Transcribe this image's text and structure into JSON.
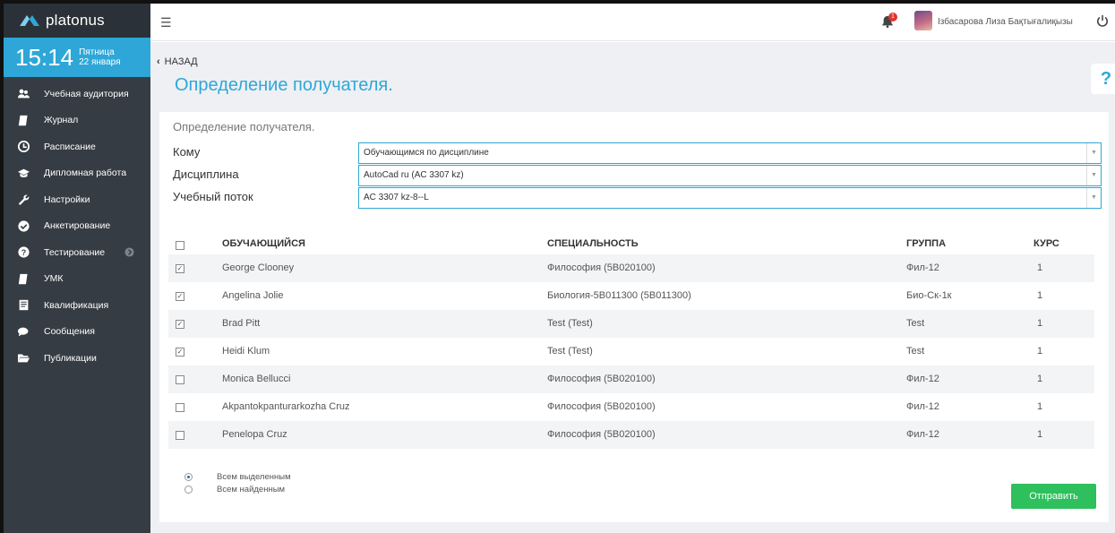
{
  "app": {
    "name": "platonus"
  },
  "clock": {
    "time": "15:14",
    "weekday": "Пятница",
    "date": "22 января"
  },
  "sidebar": {
    "items": [
      {
        "label": "Учебная аудитория",
        "icon": "users-icon"
      },
      {
        "label": "Журнал",
        "icon": "book-icon"
      },
      {
        "label": "Расписание",
        "icon": "clock-icon"
      },
      {
        "label": "Дипломная работа",
        "icon": "graduation-cap-icon"
      },
      {
        "label": "Настройки",
        "icon": "wrench-icon"
      },
      {
        "label": "Анкетирование",
        "icon": "check-circle-icon"
      },
      {
        "label": "Тестирование",
        "icon": "question-circle-icon"
      },
      {
        "label": "УМК",
        "icon": "book-icon"
      },
      {
        "label": "Квалификация",
        "icon": "document-icon"
      },
      {
        "label": "Сообщения",
        "icon": "comments-icon"
      },
      {
        "label": "Публикации",
        "icon": "folder-open-icon"
      }
    ]
  },
  "header": {
    "notifications_count": "1",
    "user_name": "Ізбасарова Лиза Бақтығалиқызы"
  },
  "page": {
    "back_label": "НАЗАД",
    "title": "Определение получателя.",
    "help_label": "?"
  },
  "panel": {
    "title": "Определение получателя.",
    "fields": {
      "to": {
        "label": "Кому",
        "value": "Обучающимся по дисциплине"
      },
      "discipline": {
        "label": "Дисциплина",
        "value": "AutoCad ru (AC 3307 kz)"
      },
      "stream": {
        "label": "Учебный поток",
        "value": "AC 3307 kz-8--L"
      }
    }
  },
  "table": {
    "columns": [
      "ОБУЧАЮЩИЙСЯ",
      "СПЕЦИАЛЬНОСТЬ",
      "ГРУППА",
      "КУРС"
    ],
    "rows": [
      {
        "checked": true,
        "student": "George Clooney",
        "specialty": "Философия (5B020100)",
        "group": "Фил-12",
        "course": "1"
      },
      {
        "checked": true,
        "student": "Angelina Jolie",
        "specialty": "Биология-5В011300 (5В011300)",
        "group": "Био-Ск-1к",
        "course": "1"
      },
      {
        "checked": true,
        "student": "Brad Pitt",
        "specialty": "Test (Test)",
        "group": "Test",
        "course": "1"
      },
      {
        "checked": true,
        "student": "Heidi Klum",
        "specialty": "Test (Test)",
        "group": "Test",
        "course": "1"
      },
      {
        "checked": false,
        "student": "Monica Bellucci",
        "specialty": "Философия (5B020100)",
        "group": "Фил-12",
        "course": "1"
      },
      {
        "checked": false,
        "student": "Akpantokpanturarkozha Cruz",
        "specialty": "Философия (5B020100)",
        "group": "Фил-12",
        "course": "1"
      },
      {
        "checked": false,
        "student": "Penelopa Cruz",
        "specialty": "Философия (5B020100)",
        "group": "Фил-12",
        "course": "1"
      }
    ]
  },
  "send_scope": {
    "options": [
      {
        "label": "Всем выделенным",
        "selected": true
      },
      {
        "label": "Всем найденным",
        "selected": false
      }
    ]
  },
  "actions": {
    "send_label": "Отправить"
  },
  "colors": {
    "accent": "#2ea7d8",
    "sidebar": "#353c44",
    "send": "#2ec05c"
  }
}
